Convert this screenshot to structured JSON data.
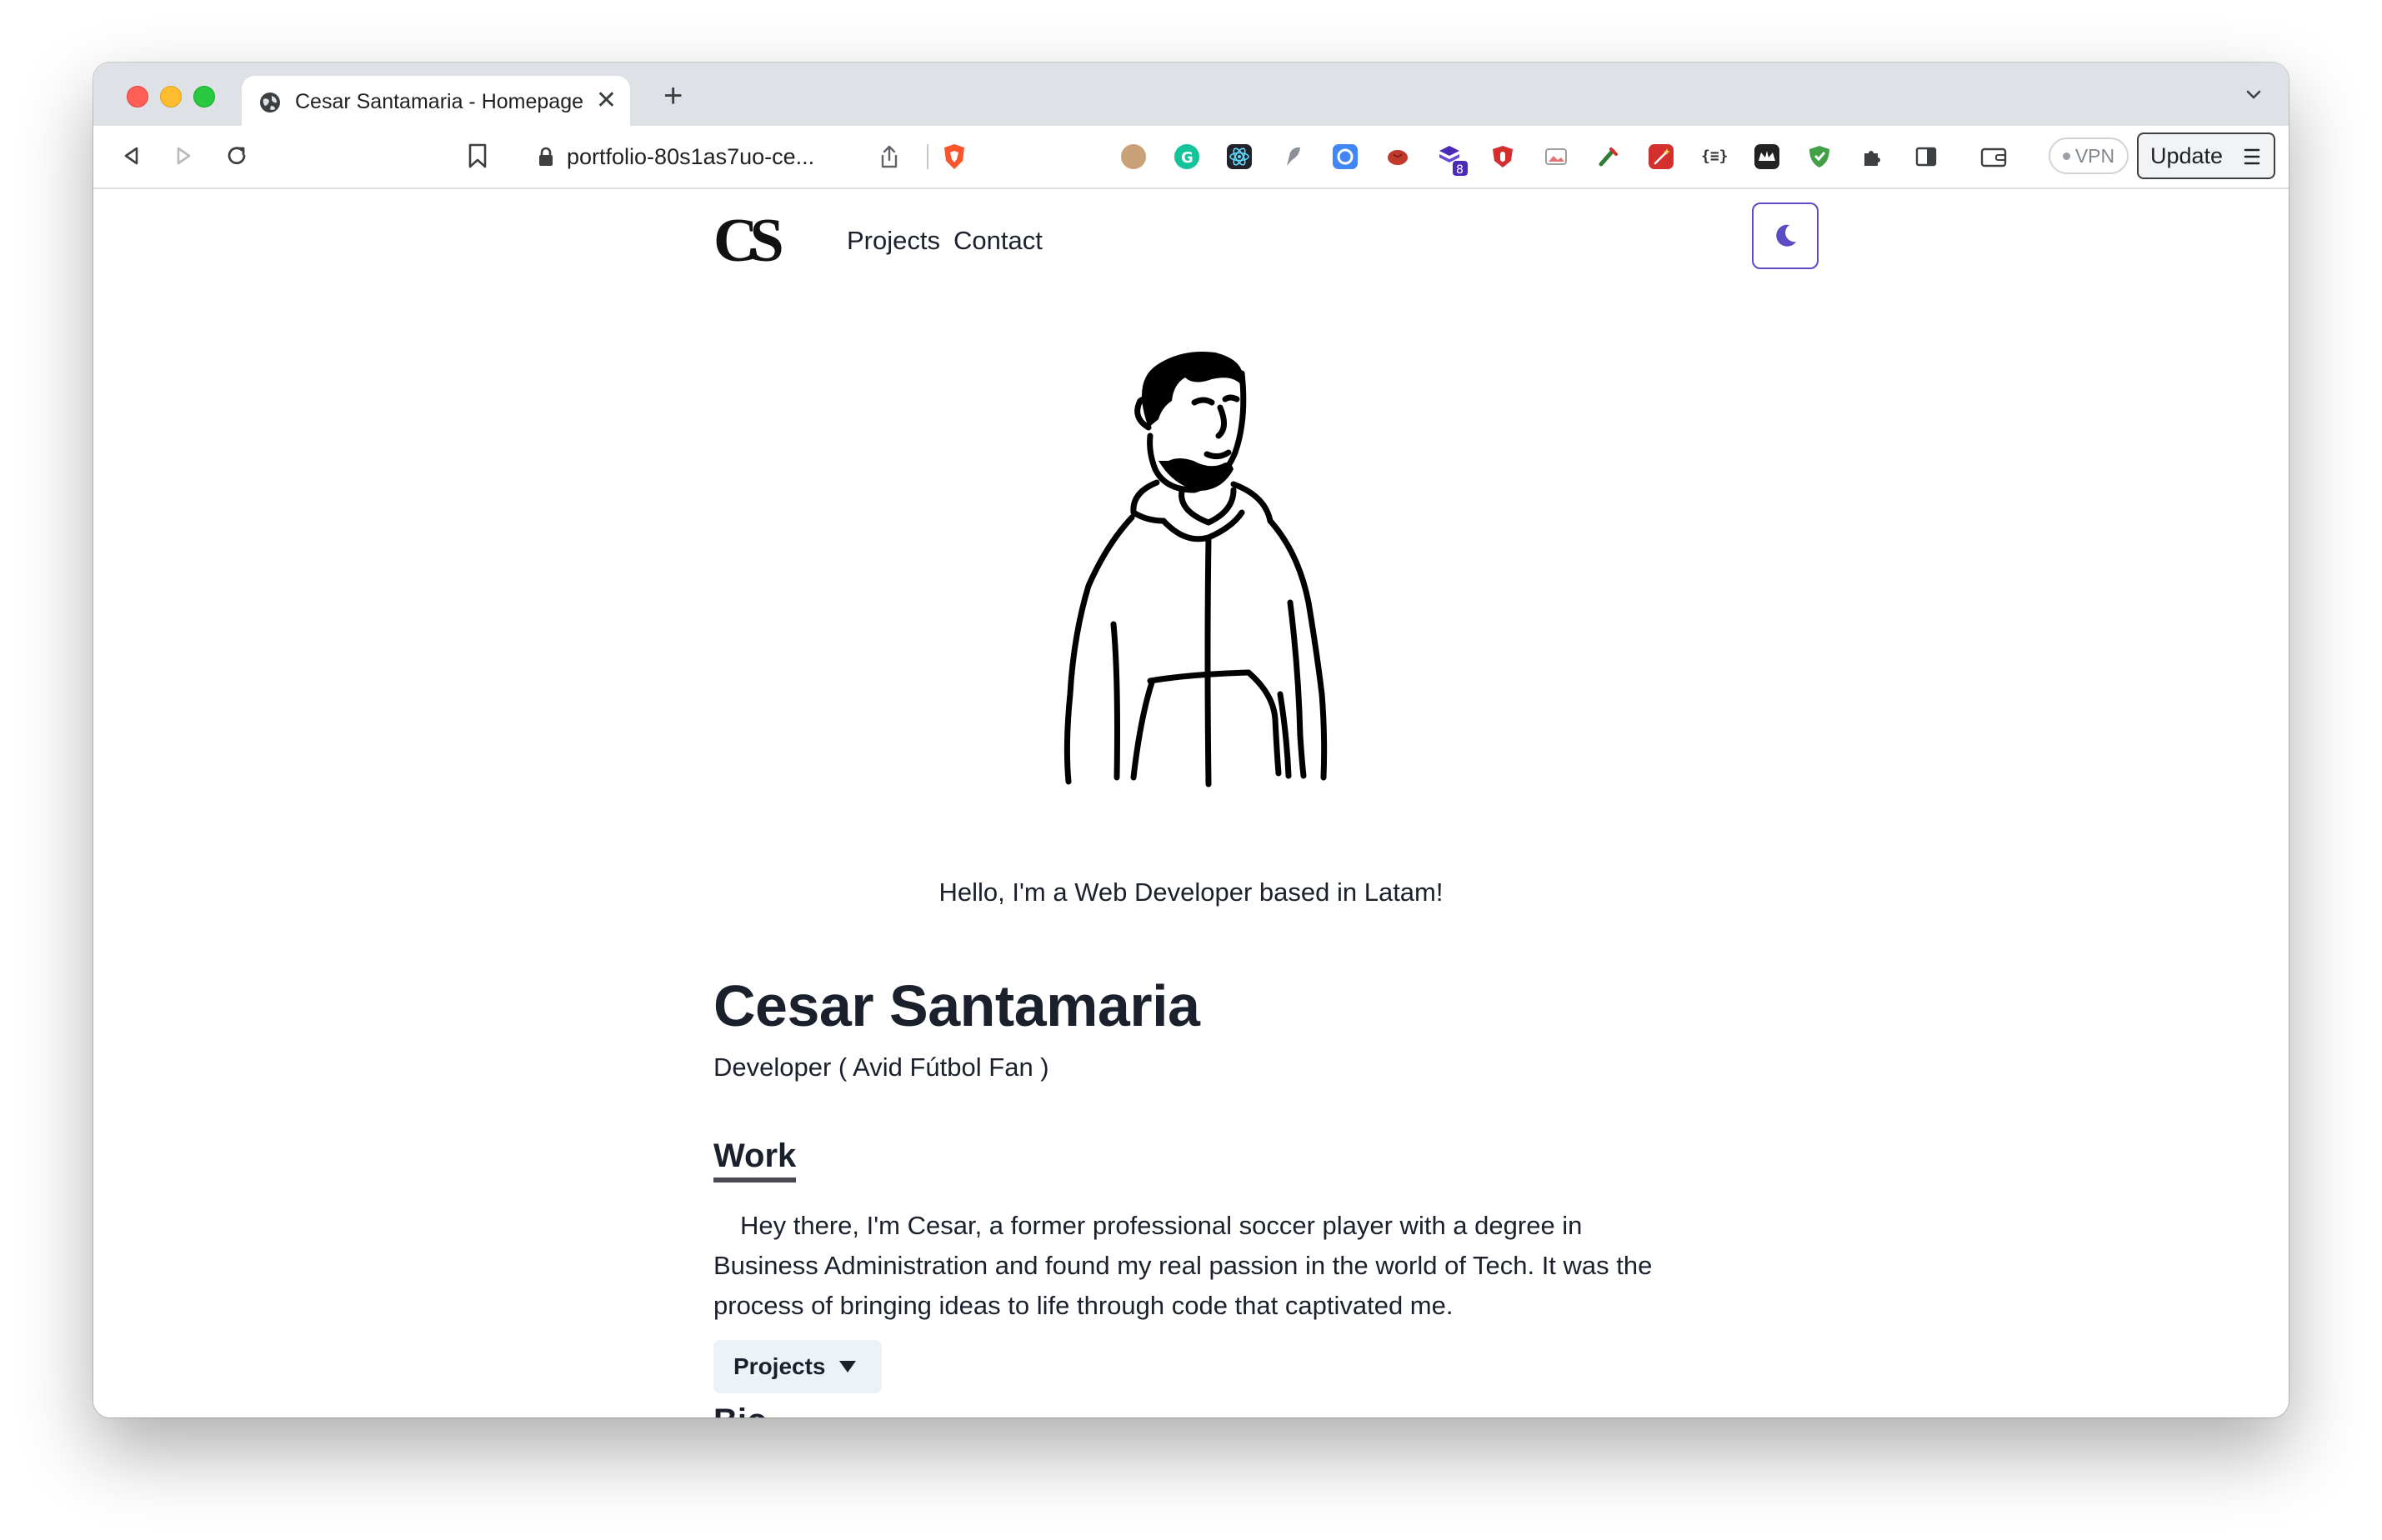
{
  "browser": {
    "tab_title": "Cesar Santamaria - Homepage",
    "tab_close": "✕",
    "new_tab": "+",
    "url": "portfolio-80s1as7uo-ce...",
    "vpn_label": "VPN",
    "update_label": "Update",
    "extensions": [
      {
        "name": "avatar-ext-icon",
        "color": "#c9a27a"
      },
      {
        "name": "grammarly-icon",
        "color": "#15c39a"
      },
      {
        "name": "react-devtools-icon",
        "color": "#20232a"
      },
      {
        "name": "quill-ext-icon",
        "color": "#8a8f98"
      },
      {
        "name": "shield-blue-ext-icon",
        "color": "#4285f4"
      },
      {
        "name": "brain-ext-icon",
        "color": "#c0392b"
      },
      {
        "name": "stacks-ext-icon",
        "color": "#4b2bb5",
        "badge": "8"
      },
      {
        "name": "ublock-icon",
        "color": "#d32f2f"
      },
      {
        "name": "image-ext-icon",
        "color": "#9e9e9e"
      },
      {
        "name": "color-picker-icon",
        "color": "#2e7d32"
      },
      {
        "name": "magic-wand-icon",
        "color": "#d32f2f"
      },
      {
        "name": "json-viewer-icon",
        "color": "#333333",
        "label": "{≡}"
      },
      {
        "name": "crown-ext-icon",
        "color": "#222222"
      },
      {
        "name": "adguard-icon",
        "color": "#43a047"
      },
      {
        "name": "puzzle-extensions-icon",
        "color": "#5f6368"
      },
      {
        "name": "sidebar-icon",
        "color": "#3c4043"
      },
      {
        "name": "wallet-icon",
        "color": "#3c4043"
      }
    ]
  },
  "site": {
    "logo_text": "CS",
    "nav": [
      {
        "label": "Projects"
      },
      {
        "label": "Contact"
      }
    ],
    "accent_color": "#5b4bc4",
    "greeting": "Hello, I'm a Web Developer based in Latam!",
    "name": "Cesar Santamaria",
    "subtitle": "Developer ( Avid Fútbol Fan )",
    "work": {
      "heading": "Work",
      "paragraph": "Hey there, I'm Cesar, a former professional soccer player with a degree in Business Administration and found my real passion in the world of Tech. It was the process of bringing ideas to life through code that captivated me.",
      "button_label": "Projects"
    },
    "bio": {
      "heading": "Bio"
    }
  }
}
